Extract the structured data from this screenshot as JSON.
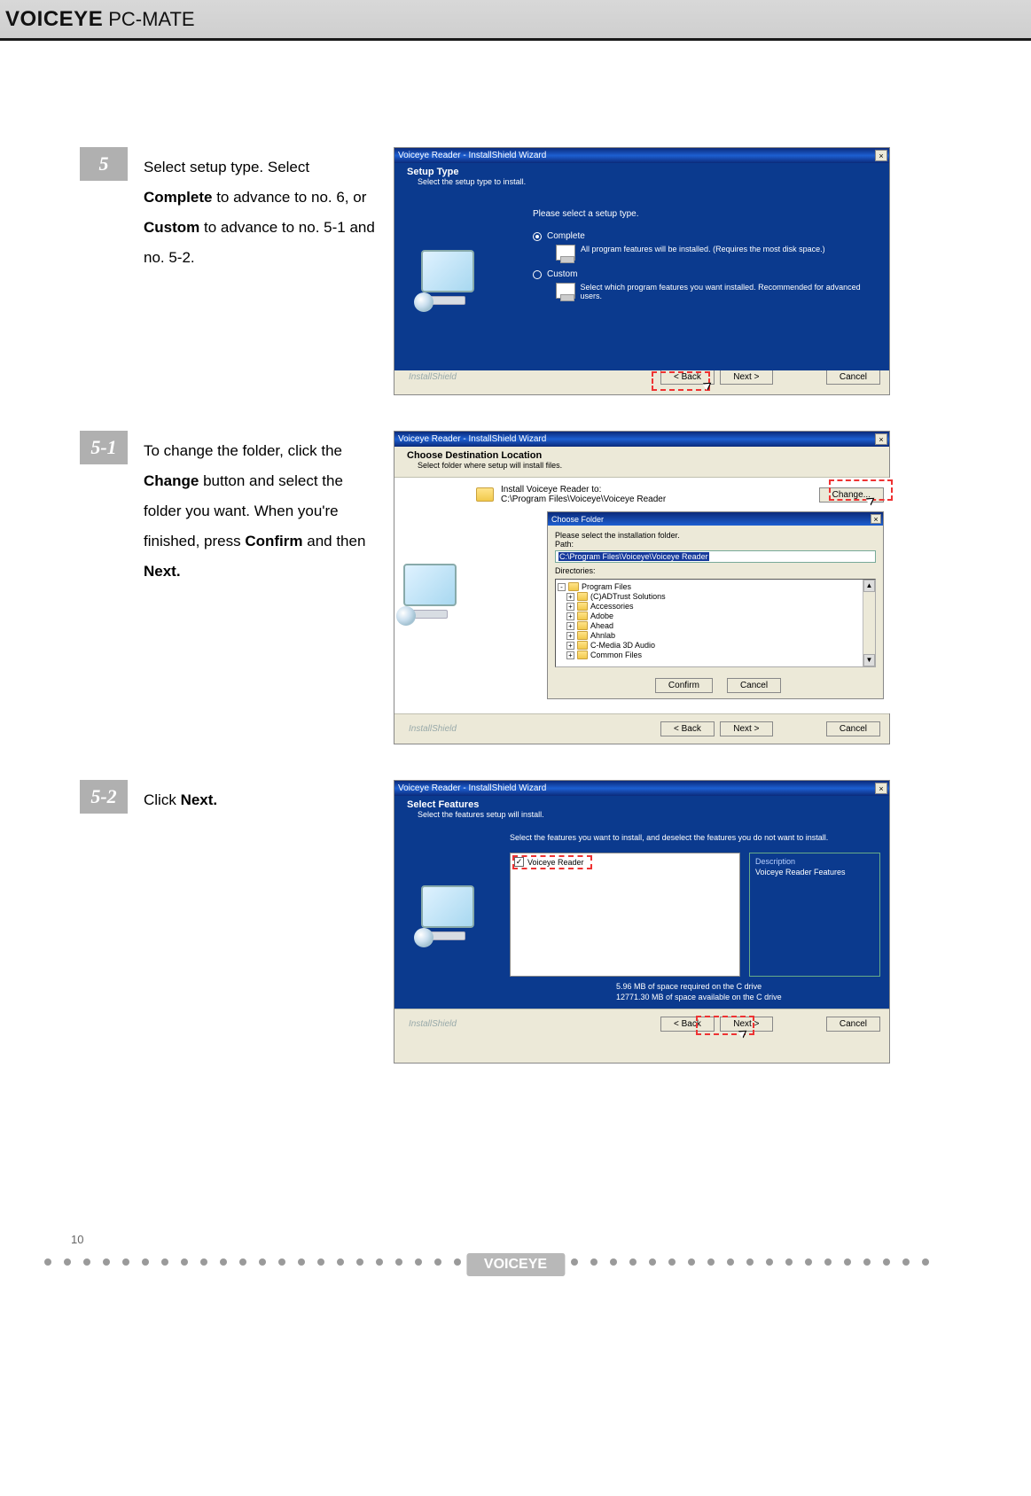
{
  "header": {
    "logo1": "VOICEYE",
    "logo2": "PC-MATE"
  },
  "page_number": "10",
  "footer_brand": "VOICEYE",
  "steps": {
    "s5": {
      "num": "5",
      "text_parts": [
        "Select setup type. Select ",
        "Complete",
        " to advance to no. 6, or ",
        "Custom",
        " to advance to no. 5-1 and no. 5-2."
      ],
      "shot": {
        "titlebar": "Voiceye Reader - InstallShield Wizard",
        "hdr_title": "Setup Type",
        "hdr_sub": "Select the setup type to install.",
        "prompt": "Please select a setup type.",
        "opt1_label": "Complete",
        "opt1_desc": "All program features will be installed. (Requires the most disk space.)",
        "opt2_label": "Custom",
        "opt2_desc": "Select which program features you want installed. Recommended for advanced users.",
        "btn_back": "< Back",
        "btn_next": "Next >",
        "btn_cancel": "Cancel",
        "brand": "InstallShield"
      }
    },
    "s51": {
      "num": "5-1",
      "text_parts": [
        "To change the folder, click the ",
        "Change",
        " button and select the folder you want. When you're finished, press ",
        "Confirm",
        " and then ",
        "Next."
      ],
      "shot": {
        "titlebar": "Voiceye Reader - InstallShield Wizard",
        "hdr_title": "Choose Destination Location",
        "hdr_sub": "Select folder where setup will install files.",
        "install_label": "Install Voiceye Reader to:",
        "install_path": "C:\\Program Files\\Voiceye\\Voiceye Reader",
        "btn_change": "Change...",
        "inner_title": "Choose Folder",
        "inner_prompt": "Please select the installation folder.",
        "path_label": "Path:",
        "path_value": "C:\\Program Files\\Voiceye\\Voiceye Reader",
        "dir_label": "Directories:",
        "tree_items": [
          "Program Files",
          "(C)ADTrust Solutions",
          "Accessories",
          "Adobe",
          "Ahead",
          "Ahnlab",
          "C-Media 3D Audio",
          "Common Files"
        ],
        "btn_confirm": "Confirm",
        "btn_cancel_inner": "Cancel",
        "btn_back": "< Back",
        "btn_next": "Next >",
        "btn_cancel": "Cancel",
        "brand": "InstallShield"
      }
    },
    "s52": {
      "num": "5-2",
      "text_parts": [
        "Click ",
        "Next."
      ],
      "shot": {
        "titlebar": "Voiceye Reader - InstallShield Wizard",
        "hdr_title": "Select Features",
        "hdr_sub": "Select the features setup will install.",
        "instr": "Select the features you want to install, and deselect the features you do not want to install.",
        "feature": "Voiceye Reader",
        "desc_title": "Description",
        "desc_body": "Voiceye Reader Features",
        "space1": "5.96 MB of space required on the C drive",
        "space2": "12771.30 MB of space available on the C drive",
        "btn_back": "< Back",
        "btn_next": "Next >",
        "btn_cancel": "Cancel",
        "brand": "InstallShield"
      }
    }
  }
}
